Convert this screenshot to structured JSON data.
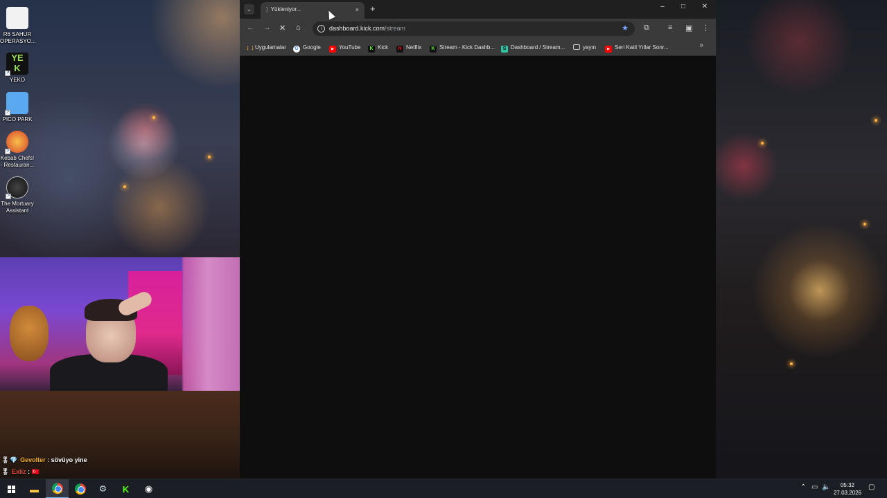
{
  "desktop": {
    "icons": [
      {
        "label": "R6 SAHUR OPERASYO...",
        "icon": "r6-sahur-icon",
        "color": "#f2f2f2"
      },
      {
        "label": "YEKO",
        "icon": "yeko-icon",
        "color": "#9be25a"
      },
      {
        "label": "PICO PARK",
        "icon": "pico-park-icon",
        "color": "#5aa8f0"
      },
      {
        "label": "Kebab Chefs! - Restauran...",
        "icon": "kebab-chefs-icon",
        "color": "#d9402a"
      },
      {
        "label": "The Mortuary Assistant",
        "icon": "mortuary-assistant-icon",
        "color": "#2a2a2a"
      }
    ]
  },
  "chat": {
    "messages": [
      {
        "user": "Gevolter",
        "separator": " : ",
        "text": "sövüyo yine",
        "user_color": "#f5b324"
      },
      {
        "user": "Exliz",
        "separator": " : ",
        "text": "🇹🇷",
        "user_color": "#e14b3a"
      }
    ]
  },
  "browser": {
    "tab": {
      "title": "Yükleniyor...",
      "close": "×"
    },
    "new_tab": "+",
    "window_controls": {
      "minimize": "–",
      "maximize": "□",
      "close": "✕"
    },
    "address": {
      "domain": "dashboard.kick.com",
      "path": "/stream"
    },
    "bookmarks": [
      {
        "label": "Uygulamalar",
        "icon": "apps-grid-icon",
        "color": "#e8a33d"
      },
      {
        "label": "Google",
        "icon": "google-icon",
        "color": "#ffffff"
      },
      {
        "label": "YouTube",
        "icon": "youtube-icon",
        "color": "#ff0000"
      },
      {
        "label": "Kick",
        "icon": "kick-icon",
        "color": "#53fc18"
      },
      {
        "label": "Netflix",
        "icon": "netflix-icon",
        "color": "#e50914"
      },
      {
        "label": "Stream - Kick Dashb...",
        "icon": "kick-icon",
        "color": "#53fc18"
      },
      {
        "label": "Dashboard / Stream...",
        "icon": "streamlabs-icon",
        "color": "#31c3a2"
      },
      {
        "label": "yayın",
        "icon": "folder-icon",
        "color": "#c8c8c8"
      },
      {
        "label": "Seri Katil Yıllar Sonr...",
        "icon": "youtube-icon",
        "color": "#ff0000"
      }
    ],
    "bookmarks_more": "»"
  },
  "taskbar": {
    "time": "05:32",
    "date": "27.03.2026"
  }
}
